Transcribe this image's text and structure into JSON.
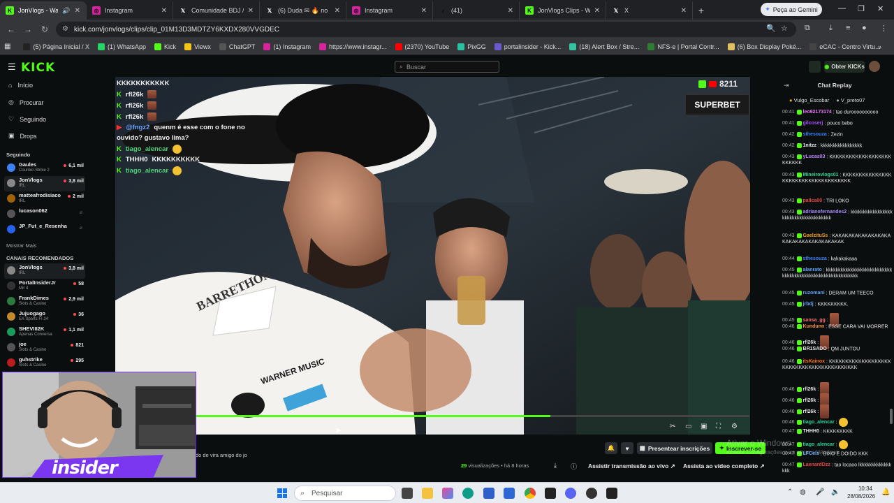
{
  "browser": {
    "tabs": [
      {
        "label": "JonVlogs - Watch",
        "icon": "kick-icon",
        "color": "#53fc18"
      },
      {
        "label": "Instagram",
        "icon": "instagram-icon",
        "color": "#d6249f"
      },
      {
        "label": "Comunidade BDJ / X",
        "icon": "x-icon",
        "color": "#ffffff"
      },
      {
        "label": "(6) Duda ✉ 🔥 no",
        "icon": "x-icon",
        "color": "#ffffff"
      },
      {
        "label": "Instagram",
        "icon": "instagram-icon",
        "color": "#d6249f"
      },
      {
        "label": "(41)",
        "icon": "tiktok-icon",
        "color": "#ffffff"
      },
      {
        "label": "JonVlogs Clips - Watc",
        "icon": "kick-icon",
        "color": "#53fc18"
      },
      {
        "label": "X",
        "icon": "x-icon",
        "color": "#ffffff"
      }
    ],
    "gemini_label": "Peça ao Gemini",
    "url": "kick.com/jonvlogs/clips/clip_01M13D3MDTZY6KXDX280VVGDEC",
    "bookmarks": [
      {
        "label": "(5) Página Inicial / X",
        "icon": "x-icon",
        "color": "#222"
      },
      {
        "label": "(1) WhatsApp",
        "icon": "whatsapp-icon",
        "color": "#25d366"
      },
      {
        "label": "Kick",
        "icon": "kick-icon",
        "color": "#53fc18"
      },
      {
        "label": "Viewx",
        "icon": "viewx-icon",
        "color": "#f5c518"
      },
      {
        "label": "ChatGPT",
        "icon": "chatgpt-icon",
        "color": "#555"
      },
      {
        "label": "(1) Instagram",
        "icon": "instagram-icon",
        "color": "#d6249f"
      },
      {
        "label": "https://www.instagr...",
        "icon": "instagram-icon",
        "color": "#d6249f"
      },
      {
        "label": "(2370) YouTube",
        "icon": "youtube-icon",
        "color": "#ff0000"
      },
      {
        "label": "PixGG",
        "icon": "pixgg-icon",
        "color": "#27c2a0"
      },
      {
        "label": "portalinsider - Kick...",
        "icon": "portal-icon",
        "color": "#6a5acd"
      },
      {
        "label": "(18) Alert Box / Stre...",
        "icon": "alertbox-icon",
        "color": "#31c3a2"
      },
      {
        "label": "NFS-e | Portal Contr...",
        "icon": "nfse-icon",
        "color": "#2e7d32"
      },
      {
        "label": "(6) Box Display Poké...",
        "icon": "pokemon-icon",
        "color": "#e0c060"
      },
      {
        "label": "eCAC - Centro Virtu...",
        "icon": "ecac-icon",
        "color": "#444"
      }
    ]
  },
  "kick": {
    "logo": "KICK",
    "search_placeholder": "Buscar",
    "obter_kicks": "Obter KICKs",
    "nav": [
      {
        "label": "Início",
        "icon": "home-icon"
      },
      {
        "label": "Procurar",
        "icon": "compass-icon"
      },
      {
        "label": "Seguindo",
        "icon": "heart-icon"
      },
      {
        "label": "Drops",
        "icon": "gift-icon"
      }
    ],
    "following_header": "Seguindo",
    "following": [
      {
        "name": "Gaules",
        "cat": "Counter-Strike 2",
        "viewers": "6,1 mil",
        "color": "#3b82f6"
      },
      {
        "name": "JonVlogs",
        "cat": "IRL",
        "viewers": "3,8 mil",
        "color": "#888",
        "selected": true
      },
      {
        "name": "matteafrodisiaco",
        "cat": "IRL",
        "viewers": "2 mil",
        "color": "#a16207"
      },
      {
        "name": "lucason062",
        "cat": "",
        "viewers": "",
        "color": "#555"
      },
      {
        "name": "JP_Fut_e_Resenha",
        "cat": "",
        "viewers": "",
        "color": "#2563eb"
      }
    ],
    "mostrar_mais": "Mostrar Mais",
    "recommended_header": "CANAIS RECOMENDADOS",
    "recommended": [
      {
        "name": "JonVlogs",
        "cat": "IRL",
        "viewers": "3,8 mil",
        "color": "#888",
        "selected": true
      },
      {
        "name": "PortalInsiderJr",
        "cat": "Mir 4",
        "viewers": "58",
        "color": "#333"
      },
      {
        "name": "FrankDimes",
        "cat": "Slots & Casino",
        "viewers": "2,9 mil",
        "color": "#2c7a3f"
      },
      {
        "name": "Jujuogago",
        "cat": "EA Sports FI 24",
        "viewers": "36",
        "color": "#c08a2d"
      },
      {
        "name": "SHEVIII2K",
        "cat": "Apenas Conversa",
        "viewers": "1,1 mil",
        "color": "#1c9a5c"
      },
      {
        "name": "joe",
        "cat": "Slots & Casino",
        "viewers": "821",
        "color": "#555"
      },
      {
        "name": "guhstrike",
        "cat": "Slots & Casino",
        "viewers": "295",
        "color": "#b91c1c"
      }
    ]
  },
  "video": {
    "overlay_chat": [
      {
        "user": "",
        "text": "KKKKKKKKKKK",
        "badge": false
      },
      {
        "user": "rfl26k",
        "text": "",
        "badge": true,
        "emote": true
      },
      {
        "user": "rfl26k",
        "text": "",
        "badge": true,
        "emote": true
      },
      {
        "user": "rfl26k",
        "text": "",
        "badge": true,
        "emote": true
      },
      {
        "user": "@fngz2",
        "text": "quenm é esse com o fone no",
        "badge": true,
        "yt": true
      },
      {
        "user": "",
        "text": "ouvido? gustavo lima?",
        "badge": false
      },
      {
        "user": "tiago_alencar",
        "text": "",
        "badge": true,
        "emoji": true
      },
      {
        "user": "THHH0",
        "text": "KKKKKKKKKK",
        "badge": true
      },
      {
        "user": "tiago_alencar",
        "text": "",
        "badge": true,
        "emoji": true
      }
    ],
    "viewer_overlay": "8211",
    "sponsor": "SUPERBET",
    "progress": 0.64,
    "caption_fragment": "do de vira amigo do jo"
  },
  "below_video": {
    "gift_label": "Presentear inscrições",
    "subscribe_label": "Inscrever-se",
    "views_count": "29",
    "views_label": "visualizações",
    "age": "há 8 horas",
    "watch_live": "Assistir transmissão ao vivo",
    "watch_full": "Assista ao vídeo completo"
  },
  "chat_replay": {
    "title": "Chat Replay",
    "pinned": [
      "Vulgo_Escobar",
      "V_preto07"
    ],
    "messages": [
      {
        "t": "00:41",
        "u": "leo92173174",
        "c": "#e879f9",
        "m": "tao duroooooooooo"
      },
      {
        "t": "00:41",
        "u": "gilcoserj",
        "c": "#a855f7",
        "m": "pouco bebo"
      },
      {
        "t": "00:42",
        "u": "sthesouza",
        "c": "#3b82f6",
        "m": "Zezin"
      },
      {
        "t": "00:42",
        "u": "1nitzz",
        "c": "#e5e5e5",
        "m": "kkkkkkkkkkkkkkkkk"
      },
      {
        "t": "00:43",
        "u": "yLucas03",
        "c": "#c084fc",
        "m": "KKKKKKKKKKKKKKKKKKKKKKKKK"
      },
      {
        "t": "00:43",
        "u": "Mineirovlogs01",
        "c": "#34d399",
        "m": "KKKKKKKKKKKKKKKKKKKKKKKKKKKKKKKKKKKK"
      },
      {
        "t": "00:43",
        "u": "pallca00",
        "c": "#ef4444",
        "m": "TRI LOKO"
      },
      {
        "t": "00:43",
        "u": "adrianofernandes2",
        "c": "#a78bfa",
        "m": "kkkkkkkkkkkkkkkkkkkkkkkkkkkkkkkkkkkkk"
      },
      {
        "t": "00:43",
        "u": "GaelzituSs",
        "c": "#f59e0b",
        "m": "KAKAKAKAKAKAKAKAKAKAKAKAKAKAKAKAKAKAK"
      },
      {
        "t": "00:44",
        "u": "sthesouza",
        "c": "#3b82f6",
        "m": "kakakakaaa"
      },
      {
        "t": "00:45",
        "u": "alanrato",
        "c": "#60a5fa",
        "m": "kkkkkkkkkkkkkkkkkkkkkkkkkkkkkkkkkkkkkkkkkkkkkkkkkkkkkkkkkk"
      },
      {
        "t": "00:45",
        "u": "ruzomani",
        "c": "#60a5fa",
        "m": "DERAM UM TEECO"
      },
      {
        "t": "00:45",
        "u": "jrbdj",
        "c": "#60a5fa",
        "m": "KKKKKKKKK."
      },
      {
        "t": "00:45",
        "u": "sansa_gg",
        "c": "#f87171",
        "m": ""
      },
      {
        "t": "00:46",
        "u": "Kundunn",
        "c": "#fb923c",
        "m": "ESSE CARA VAI MORRER"
      },
      {
        "t": "00:46",
        "u": "rfl26k",
        "c": "#e5e5e5",
        "m": ""
      },
      {
        "t": "00:46",
        "u": "BR1SADO",
        "c": "#e5e5e5",
        "m": "QM JUNTOU"
      },
      {
        "t": "00:46",
        "u": "itsKainox",
        "c": "#f97316",
        "m": "KKKKKKKKKKKKKKKKKKKKKKKKKKKKKKKKKKKKKKKKKK"
      },
      {
        "t": "00:46",
        "u": "rfl26k",
        "c": "#e5e5e5",
        "m": ""
      },
      {
        "t": "00:46",
        "u": "rfl26k",
        "c": "#e5e5e5",
        "m": ""
      },
      {
        "t": "00:46",
        "u": "rfl26k",
        "c": "#e5e5e5",
        "m": ""
      },
      {
        "t": "00:46",
        "u": "tiago_alencar",
        "c": "#34d399",
        "m": ""
      },
      {
        "t": "00:47",
        "u": "THHH0",
        "c": "#e5e5e5",
        "m": "KKKKKKKKK"
      },
      {
        "t": "00:47",
        "u": "tiago_alencar",
        "c": "#34d399",
        "m": ""
      },
      {
        "t": "00:47",
        "u": "LFCels",
        "c": "#60a5fa",
        "m": "BIXO E DOIDO KKK"
      },
      {
        "t": "00:47",
        "u": "LaenardDzz",
        "c": "#ef4444",
        "m": "tao locaoo lkkkkkkkkkkkkkkkk"
      }
    ]
  },
  "webcam": {
    "brand": "insider"
  },
  "taskbar": {
    "search_placeholder": "Pesquisar",
    "time": "10:34",
    "date": "28/08/2026"
  },
  "watermark": [
    "Ativar o Windows",
    "Acesse Configurações para ativar o Windows."
  ],
  "colors": {
    "kick_green": "#53fc18",
    "bg": "#0b0e0f"
  }
}
